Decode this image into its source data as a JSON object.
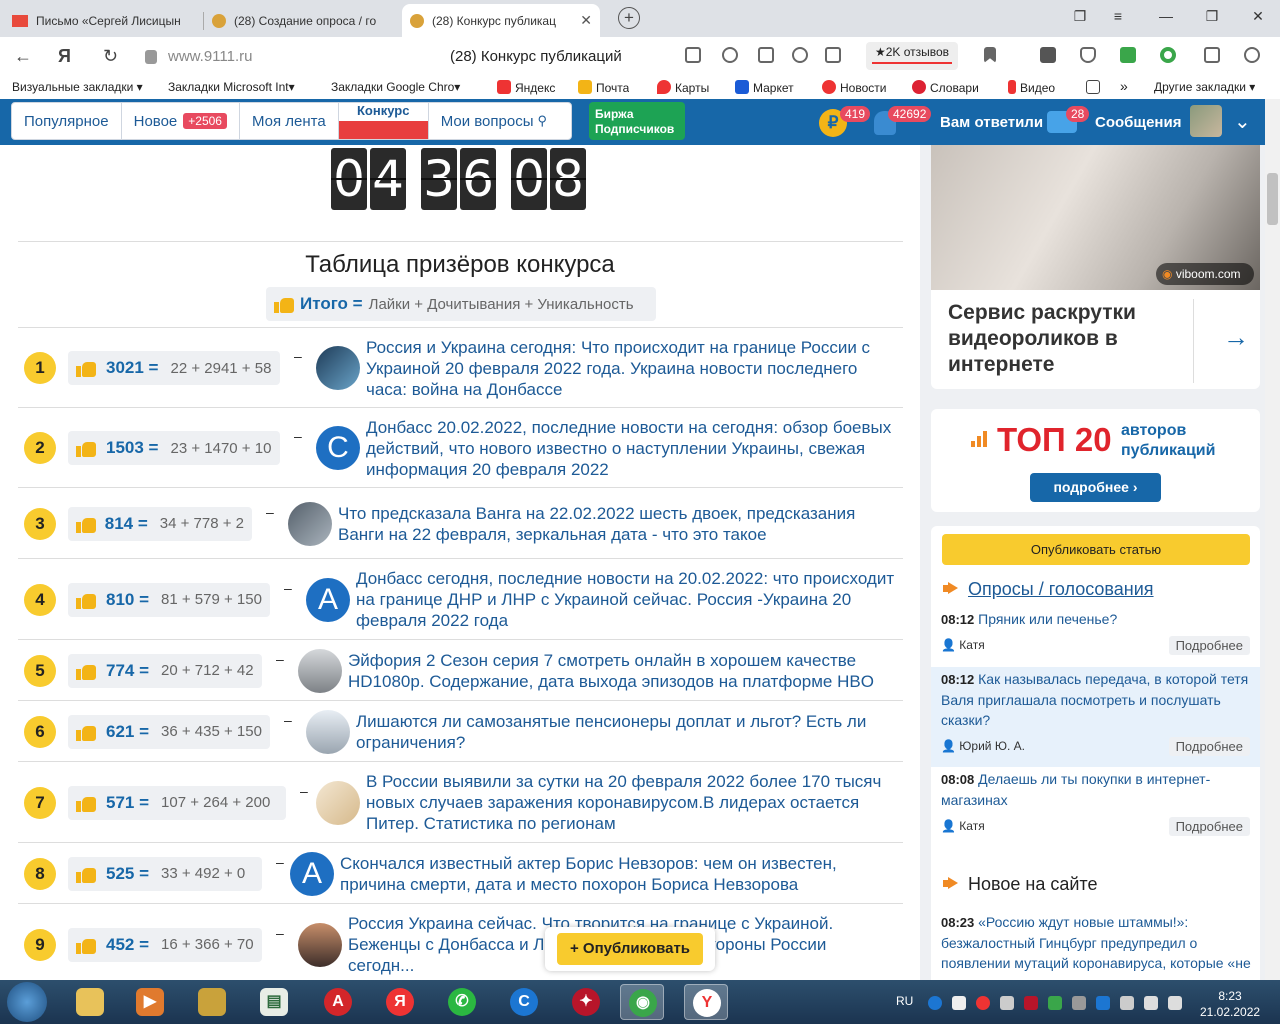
{
  "browser": {
    "tabs": [
      {
        "label": "Письмо «Сергей Лисицын",
        "color": "#e84a3c"
      },
      {
        "label": "(28) Создание опроса / го",
        "color": "#d9a23a"
      },
      {
        "label": "(28) Конкурс публикац",
        "color": "#d9a23a",
        "active": true
      }
    ],
    "url": "www.9111.ru",
    "page_title": "(28) Конкурс публикаций",
    "reviews": "★2K отзывов",
    "bookmarks": [
      {
        "label": "Визуальные закладки ▾",
        "icon": "",
        "color": ""
      },
      {
        "label": "Закладки Microsoft Int▾",
        "icon": "",
        "color": ""
      },
      {
        "label": "Закладки Google Chro▾",
        "icon": "",
        "color": ""
      },
      {
        "label": "Яндекс",
        "icon": "yandex-icon",
        "color": "#e33"
      },
      {
        "label": "Почта",
        "icon": "mail-icon",
        "color": "#f3b416"
      },
      {
        "label": "Карты",
        "icon": "maps-icon",
        "color": "#e33"
      },
      {
        "label": "Маркет",
        "icon": "market-icon",
        "color": "#1a5bd6"
      },
      {
        "label": "Новости",
        "icon": "news-icon",
        "color": "#e33"
      },
      {
        "label": "Словари",
        "icon": "dict-icon",
        "color": "#d23"
      },
      {
        "label": "Видео",
        "icon": "video-icon",
        "color": "#e33"
      },
      {
        "label": "»",
        "icon": "",
        "color": ""
      },
      {
        "label": "Другие закладки ▾",
        "icon": "",
        "color": ""
      }
    ]
  },
  "site_header": {
    "nav": [
      {
        "label": "Популярное"
      },
      {
        "label": "Новое",
        "badge": "+2506"
      },
      {
        "label": "Моя лента"
      },
      {
        "label": "Конкурс"
      },
      {
        "label": "Мои вопросы",
        "icon": "search-icon"
      }
    ],
    "birzha": "Биржа Подписчиков",
    "coin_symbol": "₽",
    "coin_count": "419",
    "bell_count": "42692",
    "answered": "Вам ответили",
    "msg_count": "28",
    "messages": "Сообщения"
  },
  "timer": {
    "digits": [
      "0",
      "4",
      "3",
      "6",
      "0",
      "8"
    ]
  },
  "prize": {
    "title": "Таблица призёров конкурса",
    "itogo_label": "Итого =",
    "itogo_formula": "Лайки + Дочитывания + Уникальность",
    "rows": [
      {
        "rank": "1",
        "total": "3021 =",
        "formula": "22 + 2941 + 58",
        "text": "Россия и Украина сегодня: Что происходит на границе России с Украиной 20 февраля 2022 года. Украина новости последнего часа: война на Донбассе",
        "avatar": "",
        "avbg": "linear-gradient(135deg,#1e3b57,#6aa4c9)"
      },
      {
        "rank": "2",
        "total": "1503 =",
        "formula": "23 + 1470 + 10",
        "text": "Донбасс 20.02.2022, последние новости на сегодня: обзор боевых действий, что нового известно о наступлении Украины, свежая информация 20 февраля 2022",
        "avatar": "С",
        "avbg": ""
      },
      {
        "rank": "3",
        "total": "814 =",
        "formula": "34 + 778 + 2",
        "text": "Что предсказала Ванга на 22.02.2022 шесть двоек, предсказания Ванги на 22 февраля, зеркальная дата - что это такое",
        "avatar": "",
        "avbg": "linear-gradient(135deg,#55606b,#aab4bd)"
      },
      {
        "rank": "4",
        "total": "810 =",
        "formula": "81 + 579 + 150",
        "text": "Донбасс сегодня, последние новости на 20.02.2022: что происходит на границе ДНР и ЛНР с Украиной сейчас. Россия -Украина 20 февраля 2022 года",
        "avatar": "А",
        "avbg": ""
      },
      {
        "rank": "5",
        "total": "774 =",
        "formula": "20 + 712 + 42",
        "text": "Эйфория 2 Сезон серия 7 смотреть онлайн в хорошем качестве HD1080p. Содержание, дата выхода эпизодов на платформе HBO",
        "avatar": "",
        "avbg": "linear-gradient(180deg,#d5d8db,#7d8186)"
      },
      {
        "rank": "6",
        "total": "621 =",
        "formula": "36 + 435 + 150",
        "text": "Лишаются ли самозанятые пенсионеры доплат и льгот? Есть ли ограничения?",
        "avatar": "",
        "avbg": "linear-gradient(180deg,#e8eef4,#9aa5b0)"
      },
      {
        "rank": "7",
        "total": "571 =",
        "formula": "107 + 264 + 200",
        "text": "В России выявили за сутки на 20 февраля 2022 более 170 тысяч новых случаев заражения коронавирусом.В лидерах остается Питер. Статистика по регионам",
        "avatar": "",
        "avbg": "linear-gradient(135deg,#f3e7d2,#d6b98b)"
      },
      {
        "rank": "8",
        "total": "525 =",
        "formula": "33 + 492 + 0",
        "text": "Скончался известный актер Борис Невзоров: чем он известен, причина смерти, дата и место похорон Бориса Невзорова",
        "avatar": "А",
        "avbg": ""
      },
      {
        "rank": "9",
        "total": "452 =",
        "formula": "16 + 366 + 70",
        "text": "Россия Украина сейчас. Что творится на границе с Украиной. Беженцы с Донбасса и Л... правда жизни со стороны России сегодн...",
        "avatar": "",
        "avbg": "linear-gradient(180deg,#c78e6a,#3d2e2a)"
      }
    ],
    "publish_button": "+ Опубликовать"
  },
  "sidebar": {
    "video_badge": "viboom.com",
    "video_text": "Сервис раскрутки видеороликов в интернете",
    "top_label": "ТОП 20",
    "top_sub": "авторов публикаций",
    "top_more": "подробнее",
    "publish_article": "Опубликовать статью",
    "polls_title": "Опросы / голосования",
    "polls": [
      {
        "time": "08:12",
        "question": "Пряник или печенье?",
        "author": "Катя",
        "more": "Подробнее"
      },
      {
        "time": "08:12",
        "question": "Как называлась передача, в которой тетя Валя приглашала посмотреть и послушать сказки?",
        "author": "Юрий Ю. А.",
        "more": "Подробнее"
      },
      {
        "time": "08:08",
        "question": "Делаешь ли ты покупки в интернет-магазинах",
        "author": "Катя",
        "more": "Подробнее"
      }
    ],
    "new_title": "Новое на сайте",
    "new_items": [
      {
        "time": "08:23",
        "text": "«Россию ждут новые штаммы!»: безжалостный Гинцбург предупредил о появлении мутаций коронавируса, которые «не реагируют на вакцины»"
      }
    ]
  },
  "taskbar": {
    "lang": "RU",
    "time": "8:23",
    "date": "21.02.2022"
  }
}
